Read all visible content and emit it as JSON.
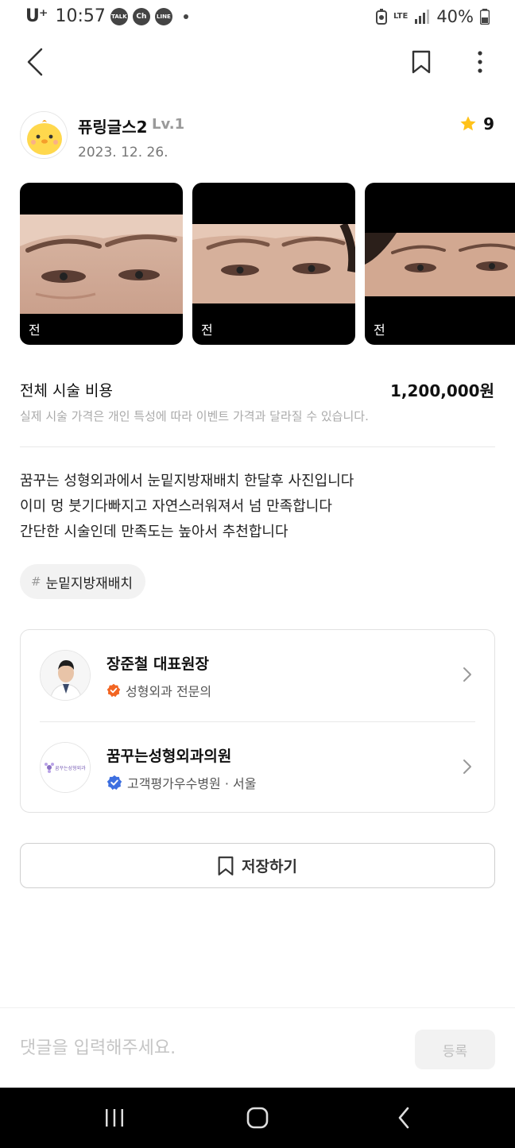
{
  "status_bar": {
    "carrier": "U⁺",
    "time": "10:57",
    "apps": [
      "TALK",
      "Ch",
      "LINE"
    ],
    "network": "LTE",
    "battery": "40%"
  },
  "author": {
    "name": "퓨링글스2",
    "level": "Lv.1",
    "date": "2023. 12. 26.",
    "rating": "9",
    "rating_color": "#FFC21A"
  },
  "photos": [
    {
      "label": "전"
    },
    {
      "label": "전"
    },
    {
      "label": "전"
    }
  ],
  "cost": {
    "label": "전체 시술 비용",
    "value": "1,200,000원",
    "note": "실제 시술 가격은 개인 특성에 따라 이벤트 가격과 달라질 수 있습니다."
  },
  "body": {
    "lines": [
      "꿈꾸는 성형외과에서 눈밑지방재배치 한달후 사진입니다",
      "이미 멍 붓기다빠지고 자연스러워져서 넘 만족합니다",
      "간단한 시술인데 만족도는 높아서 추천합니다"
    ]
  },
  "tag": {
    "hash": "#",
    "text": "눈밑지방재배치"
  },
  "doctor": {
    "name": "장준철 대표원장",
    "badge": "성형외과 전문의",
    "badge_color": "#F26522"
  },
  "hospital": {
    "name": "꿈꾸는성형외과의원",
    "badge": "고객평가우수병원 · 서울",
    "badge_color": "#3D6FE0",
    "logo_text": "꿈꾸는성형외과"
  },
  "save_button": {
    "label": "저장하기"
  },
  "comment": {
    "placeholder": "댓글을 입력해주세요.",
    "submit_label": "등록"
  }
}
